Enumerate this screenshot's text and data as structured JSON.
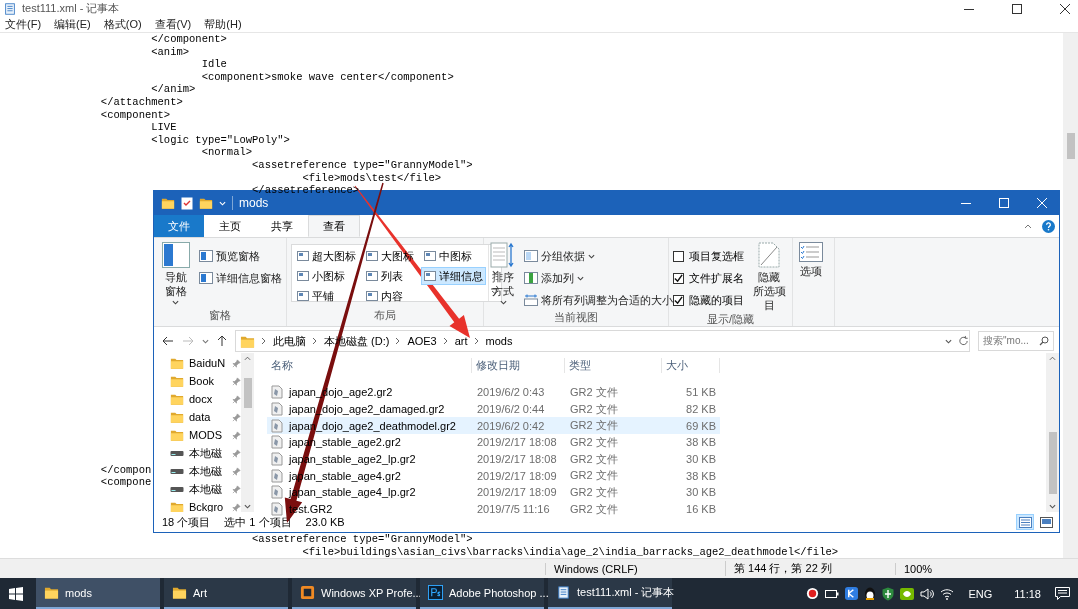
{
  "notepad": {
    "title": "test111.xml - 记事本",
    "menu": [
      "文件(F)",
      "编辑(E)",
      "格式(O)",
      "查看(V)",
      "帮助(H)"
    ],
    "lines_top": [
      "\t\t\t</component>",
      "\t\t\t<anim>",
      "\t\t\t\tIdle",
      "\t\t\t\t<component>smoke wave center</component>",
      "\t\t\t</anim>",
      "\t\t</attachment>",
      "\t\t<component>",
      "\t\t\tLIVE",
      "\t\t\t<logic type=\"LowPoly\">",
      "\t\t\t\t<normal>",
      "\t\t\t\t\t<assetreference type=\"GrannyModel\">",
      "\t\t\t\t\t\t<file>mods\\test</file>",
      "\t\t\t\t\t</assetreference>"
    ],
    "lines_middle": [
      "\t\t</compon",
      "\t\t<compone"
    ],
    "lines_bottom": [
      "\t\t\t\t\t<assetreference type=\"GrannyModel\">",
      "\t\t\t\t\t\t<file>buildings\\asian_civs\\barracks\\india\\age_2\\india_barracks_age2_deathmodel</file>"
    ],
    "status": {
      "encoding": "Windows (CRLF)",
      "position": "第 144 行，第 22 列",
      "zoom": "100%"
    }
  },
  "explorer": {
    "title": "mods",
    "tabs": [
      {
        "label": "文件",
        "kind": "menu",
        "selected": false
      },
      {
        "label": "主页",
        "kind": "tab",
        "selected": false
      },
      {
        "label": "共享",
        "kind": "tab",
        "selected": false
      },
      {
        "label": "查看",
        "kind": "tab",
        "selected": true
      }
    ],
    "ribbon": {
      "pane_group": {
        "label": "窗格",
        "navigation_pane": "导航窗格",
        "preview_pane": "预览窗格",
        "details_pane": "详细信息窗格"
      },
      "layout_group": {
        "label": "布局",
        "views": [
          {
            "label": "超大图标",
            "selected": false
          },
          {
            "label": "大图标",
            "selected": false
          },
          {
            "label": "中图标",
            "selected": false
          },
          {
            "label": "小图标",
            "selected": false
          },
          {
            "label": "列表",
            "selected": false
          },
          {
            "label": "详细信息",
            "selected": true
          },
          {
            "label": "平铺",
            "selected": false
          },
          {
            "label": "内容",
            "selected": false
          }
        ]
      },
      "current_view_group": {
        "label": "当前视图",
        "sort_by": "排序方式",
        "group_by": "分组依据",
        "add_columns": "添加列",
        "fit_columns": "将所有列调整为合适的大小"
      },
      "show_hide_group": {
        "label": "显示/隐藏",
        "options": [
          {
            "label": "项目复选框",
            "checked": false
          },
          {
            "label": "文件扩展名",
            "checked": true
          },
          {
            "label": "隐藏的项目",
            "checked": true
          }
        ],
        "hide_selected": [
          "隐藏",
          "所选项目"
        ]
      },
      "options_button": "选项"
    },
    "address": {
      "crumbs": [
        "此电脑",
        "本地磁盘 (D:)",
        "AOE3",
        "art",
        "mods"
      ]
    },
    "search": {
      "placeholder": "搜索\"mo..."
    },
    "nav_pane": [
      {
        "label": "BaiduN",
        "kind": "folder"
      },
      {
        "label": "Book",
        "kind": "folder"
      },
      {
        "label": "docx",
        "kind": "folder"
      },
      {
        "label": "data",
        "kind": "folder"
      },
      {
        "label": "MODS",
        "kind": "folder"
      },
      {
        "label": "本地磁",
        "kind": "drive"
      },
      {
        "label": "本地磁",
        "kind": "drive"
      },
      {
        "label": "本地磁",
        "kind": "drive"
      },
      {
        "label": "Bckgro",
        "kind": "folder"
      }
    ],
    "columns": [
      "名称",
      "修改日期",
      "类型",
      "大小"
    ],
    "rows": [
      {
        "name": "japan_dojo_age2.gr2",
        "date": "2019/6/2 0:43",
        "type": "GR2 文件",
        "size": "51 KB",
        "selected": false
      },
      {
        "name": "japan_dojo_age2_damaged.gr2",
        "date": "2019/6/2 0:44",
        "type": "GR2 文件",
        "size": "82 KB",
        "selected": false
      },
      {
        "name": "japan_dojo_age2_deathmodel.gr2",
        "date": "2019/6/2 0:42",
        "type": "GR2 文件",
        "size": "69 KB",
        "selected": true
      },
      {
        "name": "japan_stable_age2.gr2",
        "date": "2019/2/17 18:08",
        "type": "GR2 文件",
        "size": "38 KB",
        "selected": false
      },
      {
        "name": "japan_stable_age2_lp.gr2",
        "date": "2019/2/17 18:08",
        "type": "GR2 文件",
        "size": "30 KB",
        "selected": false
      },
      {
        "name": "japan_stable_age4.gr2",
        "date": "2019/2/17 18:09",
        "type": "GR2 文件",
        "size": "38 KB",
        "selected": false
      },
      {
        "name": "japan_stable_age4_lp.gr2",
        "date": "2019/2/17 18:09",
        "type": "GR2 文件",
        "size": "30 KB",
        "selected": false
      },
      {
        "name": "test.GR2",
        "date": "2019/7/5 11:16",
        "type": "GR2 文件",
        "size": "16 KB",
        "selected": false
      }
    ],
    "status": {
      "count": "18 个项目",
      "selection": "选中 1 个项目",
      "size": "23.0 KB"
    },
    "view_buttons": [
      {
        "kind": "details",
        "selected": true
      },
      {
        "kind": "large_icons",
        "selected": false
      }
    ]
  },
  "taskbar": {
    "items": [
      {
        "label": "mods",
        "selected": true
      },
      {
        "label": "Art",
        "selected": false
      },
      {
        "label": "Windows XP Profe...",
        "selected": false
      },
      {
        "label": "Adobe Photoshop ...",
        "selected": false
      },
      {
        "label": "test111.xml - 记事本",
        "selected": false
      }
    ],
    "language": "ENG",
    "time": "11:18"
  }
}
